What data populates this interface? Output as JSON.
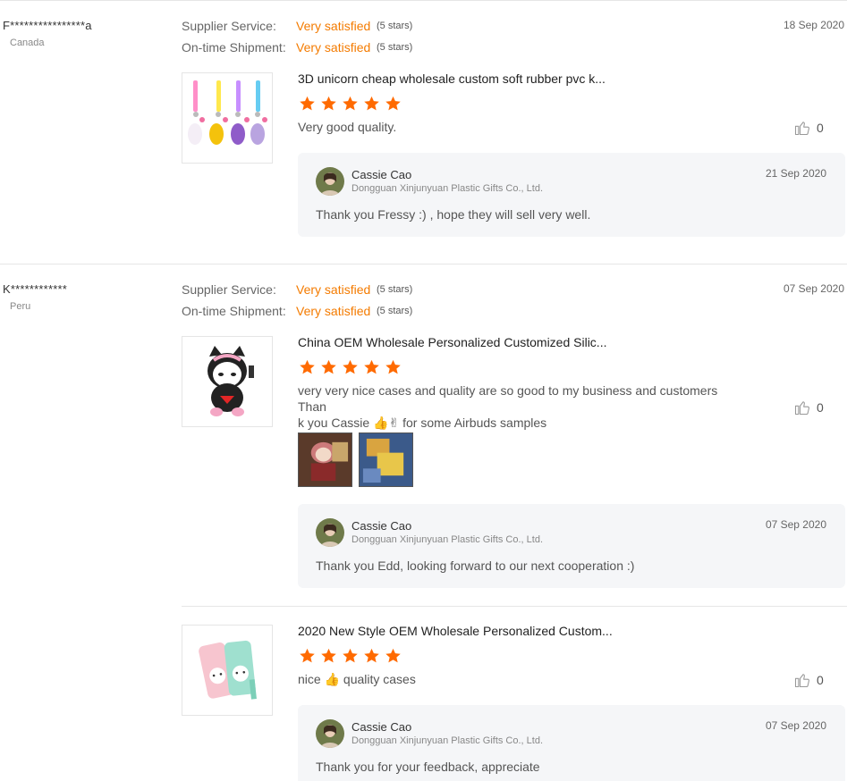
{
  "reviews": [
    {
      "buyer": "F****************a",
      "country": "Canada",
      "date": "18 Sep 2020",
      "supplier_service_label": "Supplier Service:",
      "supplier_service_value": "Very satisfied",
      "supplier_service_stars": "(5 stars)",
      "shipment_label": "On-time Shipment:",
      "shipment_value": "Very satisfied",
      "shipment_stars": "(5 stars)",
      "product_title": "3D unicorn cheap wholesale custom soft rubber pvc k...",
      "rating": 5,
      "text": "Very good quality.",
      "likes": "0",
      "reply": {
        "name": "Cassie Cao",
        "company": "Dongguan Xinjunyuan Plastic Gifts Co., Ltd.",
        "date": "21 Sep 2020",
        "text": "Thank you Fressy :) , hope they will sell very well."
      }
    },
    {
      "buyer": "K************",
      "country": "Peru",
      "date": "07 Sep 2020",
      "supplier_service_label": "Supplier Service:",
      "supplier_service_value": "Very satisfied",
      "supplier_service_stars": "(5 stars)",
      "shipment_label": "On-time Shipment:",
      "shipment_value": "Very satisfied",
      "shipment_stars": "(5 stars)",
      "product_title": "China OEM Wholesale Personalized Customized Silic...",
      "rating": 5,
      "text_line1": "very very nice cases and quality are so good to my business and customers Than",
      "text_line2_pre": "k you Cassie ",
      "text_emoji": "👍✌",
      "text_line2_post": " for some Airbuds samples",
      "likes": "0",
      "reply": {
        "name": "Cassie Cao",
        "company": "Dongguan Xinjunyuan Plastic Gifts Co., Ltd.",
        "date": "07 Sep 2020",
        "text": "Thank you Edd, looking forward to our next cooperation :)"
      }
    },
    {
      "product_title": "2020 New Style OEM Wholesale Personalized Custom...",
      "rating": 5,
      "text_pre": "nice ",
      "text_emoji": "👍",
      "text_post": " quality cases",
      "likes": "0",
      "reply": {
        "name": "Cassie Cao",
        "company": "Dongguan Xinjunyuan Plastic Gifts Co., Ltd.",
        "date": "07 Sep 2020",
        "text": "Thank you for your feedback, appreciate"
      }
    }
  ],
  "colors": {
    "accent": "#f47b00",
    "star": "#ff6a00",
    "reply_bg": "#f5f6f8"
  },
  "icons": {
    "rating_star": "star-icon",
    "like": "thumbs-up-icon"
  }
}
